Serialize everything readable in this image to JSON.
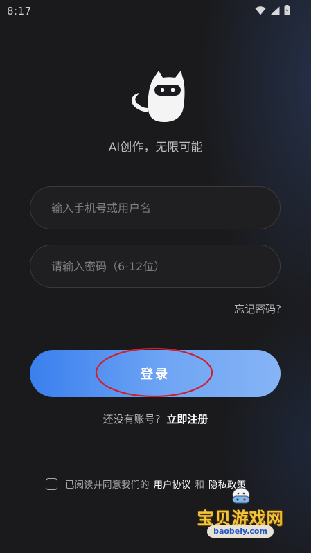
{
  "status_bar": {
    "time": "8:17",
    "icons": [
      "wifi-icon",
      "signal-icon",
      "battery-icon"
    ]
  },
  "app": {
    "logo": "cat-mascot-logo",
    "tagline": "AI创作，无限可能"
  },
  "form": {
    "phone_placeholder": "输入手机号或用户名",
    "password_placeholder": "请输入密码（6-12位）",
    "forgot_label": "忘记密码?",
    "login_label": "登录"
  },
  "register": {
    "prompt": "还没有账号?",
    "link": "立即注册"
  },
  "agreement": {
    "checked": false,
    "text": "已阅读并同意我们的",
    "user_agreement": "用户协议",
    "and": "和",
    "privacy_policy": "隐私政策"
  },
  "watermark": {
    "title": "宝贝游戏网",
    "url": "baobeiy.com"
  },
  "colors": {
    "background": "#1a1a1c",
    "button_gradient_start": "#3a7fee",
    "button_gradient_end": "#86b4f6",
    "annotation_ellipse": "#d0202e"
  }
}
